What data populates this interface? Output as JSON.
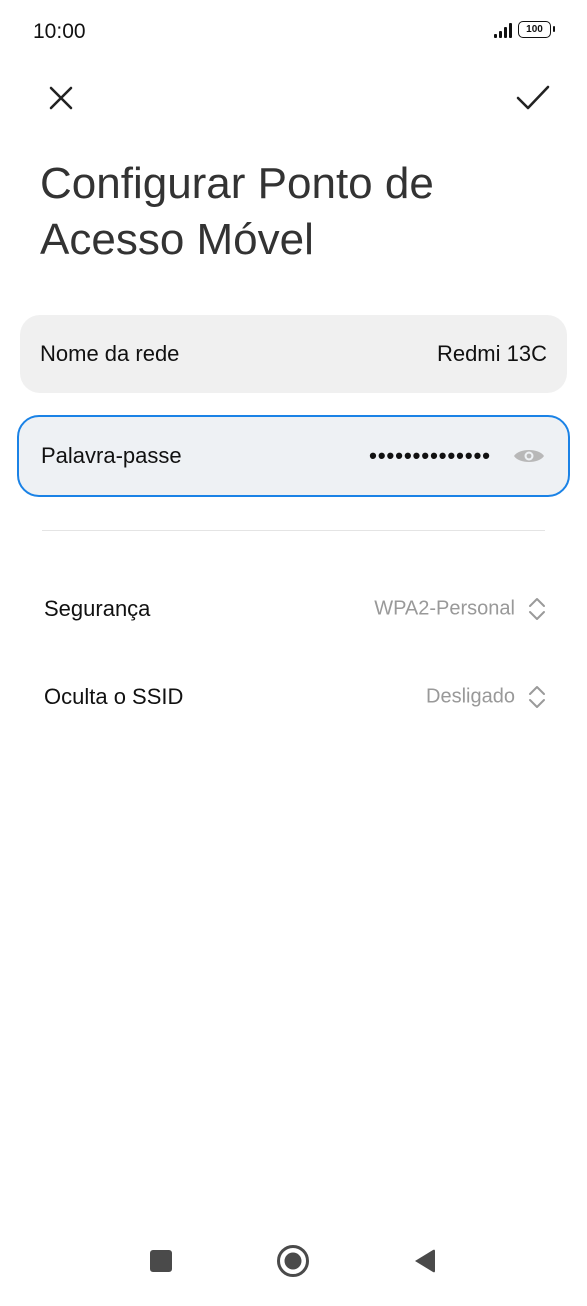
{
  "status_bar": {
    "time": "10:00",
    "battery_level": "100",
    "signal_icon": "signal-bars-icon",
    "battery_icon": "battery-icon"
  },
  "toolbar": {
    "close_icon": "close-icon",
    "confirm_icon": "check-icon"
  },
  "page": {
    "title": "Configurar Ponto de Acesso Móvel"
  },
  "network_name": {
    "label": "Nome da rede",
    "value": "Redmi 13C"
  },
  "password": {
    "label": "Palavra-passe",
    "value": "••••••••••••••",
    "visibility_icon": "eye-icon"
  },
  "settings": {
    "security": {
      "label": "Segurança",
      "value": "WPA2-Personal"
    },
    "hide_ssid": {
      "label": "Oculta o SSID",
      "value": "Desligado"
    }
  },
  "navigation": {
    "recents_icon": "square-icon",
    "home_icon": "circle-icon",
    "back_icon": "triangle-back-icon"
  },
  "colors": {
    "accent": "#1a82e6",
    "field_background": "#f0f0f0",
    "secondary_text": "#999999"
  }
}
